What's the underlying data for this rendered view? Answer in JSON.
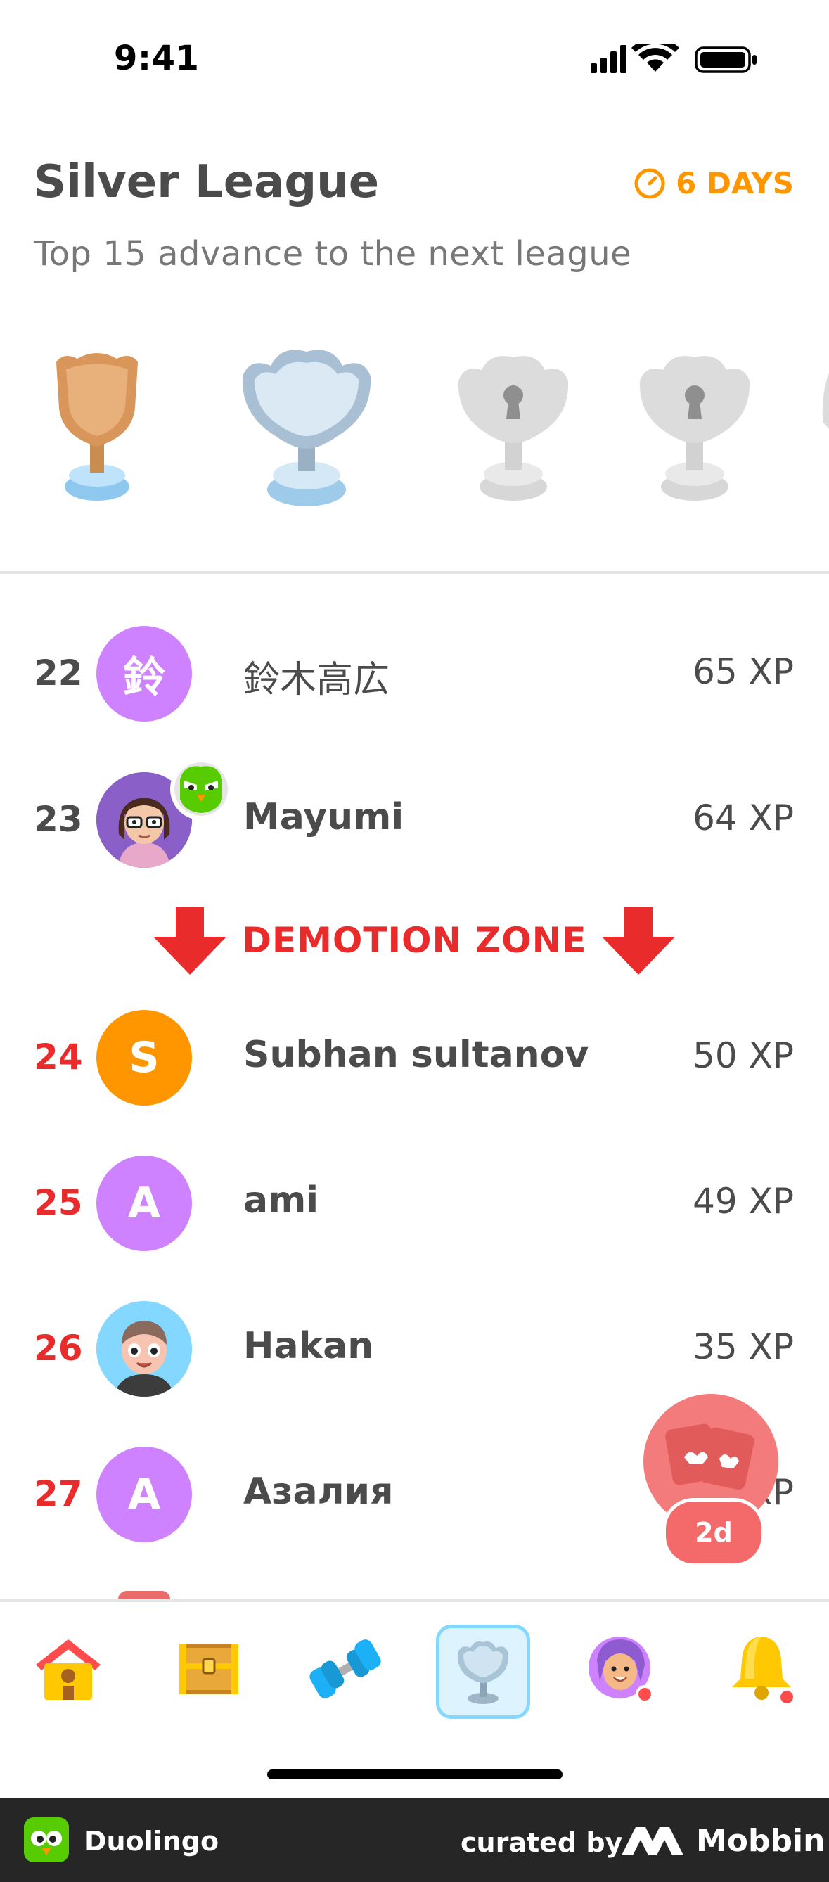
{
  "status_bar": {
    "time": "9:41"
  },
  "header": {
    "title": "Silver League",
    "timer": "6 DAYS",
    "subtitle": "Top 15 advance to the next league"
  },
  "leaderboard": [
    {
      "rank": "22",
      "name": "鈴木高広",
      "xp": "65 XP",
      "avatar_letter": "鈴",
      "avatar_color": "#ce82ff"
    },
    {
      "rank": "23",
      "name": "Mayumi",
      "xp": "64 XP",
      "avatar_letter": "",
      "avatar_color": "#7b5bb5"
    },
    {
      "rank": "24",
      "name": "Subhan sultanov",
      "xp": "50 XP",
      "avatar_letter": "S",
      "avatar_color": "#ff9600"
    },
    {
      "rank": "25",
      "name": "ami",
      "xp": "49 XP",
      "avatar_letter": "A",
      "avatar_color": "#ce82ff"
    },
    {
      "rank": "26",
      "name": "Hakan",
      "xp": "35 XP",
      "avatar_letter": "",
      "avatar_color": "#84d8ff"
    },
    {
      "rank": "27",
      "name": "Азалия",
      "xp": "XP",
      "avatar_letter": "A",
      "avatar_color": "#ce82ff"
    }
  ],
  "demotion_zone": {
    "label": "DEMOTION ZONE"
  },
  "floating_button": {
    "badge": "2d"
  },
  "nav": {
    "items": [
      {
        "icon": "home-icon"
      },
      {
        "icon": "treasure-chest-icon"
      },
      {
        "icon": "dumbbell-icon"
      },
      {
        "icon": "trophy-icon",
        "active": true
      },
      {
        "icon": "profile-icon"
      },
      {
        "icon": "bell-icon"
      }
    ]
  },
  "footer": {
    "app_name": "Duolingo",
    "curated_by": "curated by",
    "brand": "Mobbin"
  },
  "colors": {
    "accent": "#ff9600",
    "danger": "#ea2b2b",
    "text": "#4b4b4b"
  }
}
